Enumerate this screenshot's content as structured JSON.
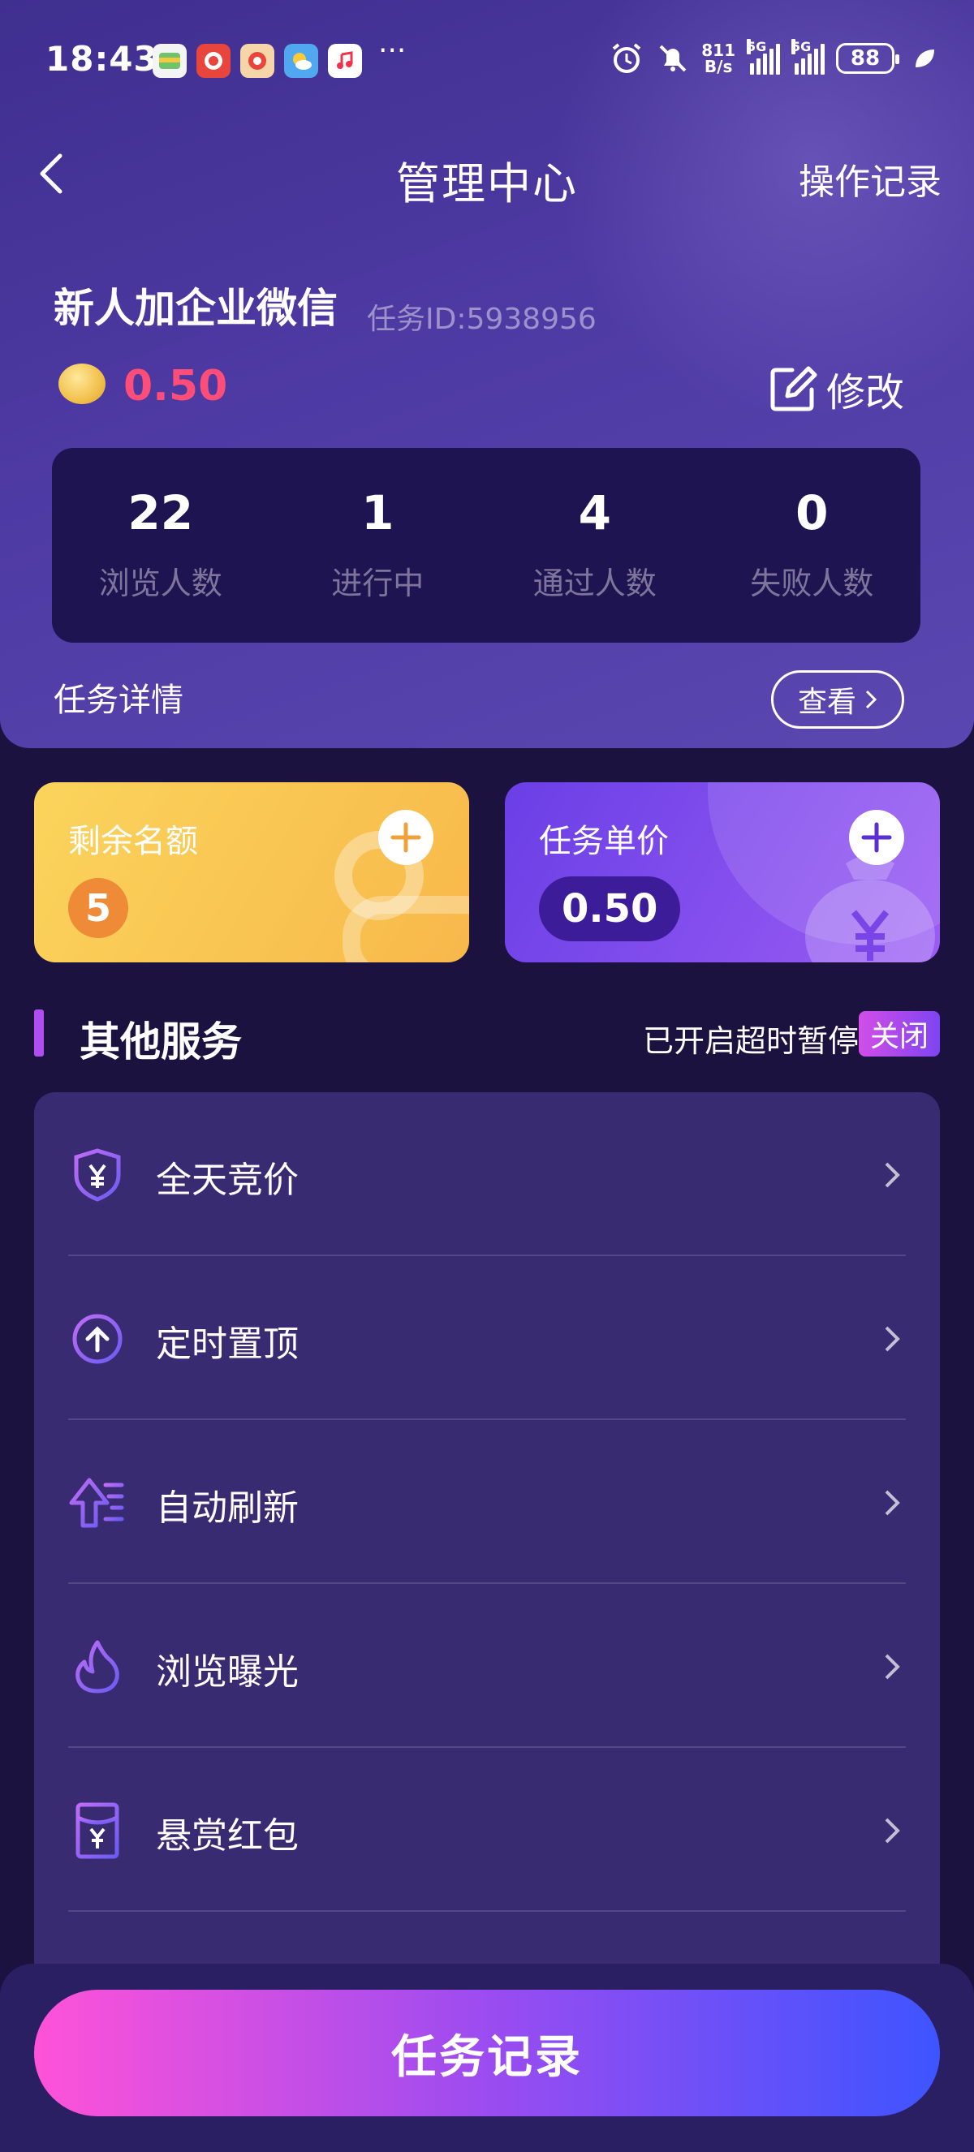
{
  "status_bar": {
    "time": "18:43",
    "app_icons": [
      "wallet-app",
      "618-app",
      "618-app-2",
      "weather-app",
      "music-app"
    ],
    "more": "···",
    "speed_top": "811",
    "speed_bottom": "B/s",
    "signal_label_1": "5G",
    "signal_label_2": "5G",
    "battery": "88"
  },
  "nav": {
    "title": "管理中心",
    "right_link": "操作记录"
  },
  "task": {
    "title": "新人加企业微信",
    "id_label": "任务ID:5938956",
    "price": "0.50",
    "edit_label": "修改"
  },
  "stats": [
    {
      "value": "22",
      "label": "浏览人数"
    },
    {
      "value": "1",
      "label": "进行中"
    },
    {
      "value": "4",
      "label": "通过人数"
    },
    {
      "value": "0",
      "label": "失败人数"
    }
  ],
  "detail": {
    "label": "任务详情",
    "button": "查看"
  },
  "cards": {
    "quota_label": "剩余名额",
    "quota_value": "5",
    "unit_price_label": "任务单价",
    "unit_price_value": "0.50"
  },
  "section": {
    "title": "其他服务",
    "status_text": "已开启超时暂停",
    "toggle_label": "关闭"
  },
  "services": [
    {
      "label": "全天竞价",
      "icon": "shield-yen-icon"
    },
    {
      "label": "定时置顶",
      "icon": "arrow-up-circle-icon"
    },
    {
      "label": "自动刷新",
      "icon": "refresh-up-icon"
    },
    {
      "label": "浏览曝光",
      "icon": "flame-icon"
    },
    {
      "label": "悬赏红包",
      "icon": "red-envelope-icon"
    }
  ],
  "bottom": {
    "button": "任务记录"
  },
  "colors": {
    "background": "#1c1240",
    "price_red": "#ff4d7a",
    "accent_purple": "#b04cf2"
  }
}
